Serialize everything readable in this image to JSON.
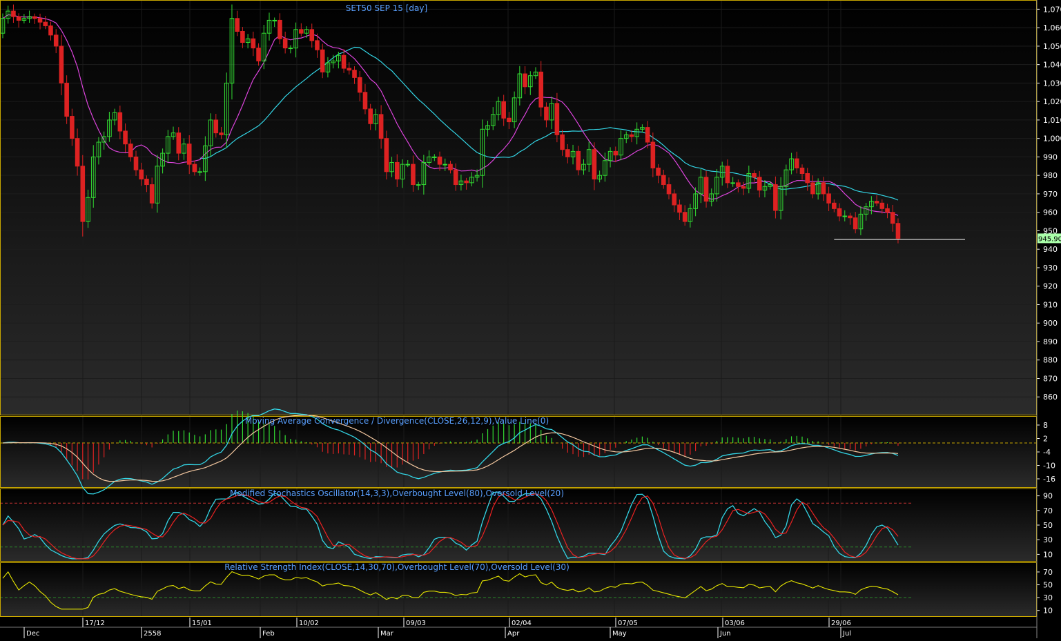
{
  "chart_data": [
    {
      "type": "candlestick",
      "title": "SET50 SEP 15   [day]",
      "ylim": [
        850,
        1075
      ],
      "yticks": [
        "1,070",
        "1,060",
        "1,050",
        "1,040",
        "1,030",
        "1,020",
        "1,010",
        "1,000",
        "990",
        "980",
        "970",
        "960",
        "950",
        "940",
        "930",
        "920",
        "910",
        "900",
        "890",
        "880",
        "870",
        "860"
      ],
      "last_price_label": "945.90",
      "support_line": 945.3,
      "close": [
        1065,
        1069,
        1066,
        1064,
        1065,
        1066,
        1065,
        1063,
        1061,
        1056,
        1050,
        1030,
        1012,
        1000,
        985,
        955,
        968,
        990,
        998,
        1001,
        1010,
        1014,
        1004,
        997,
        990,
        983,
        978,
        975,
        965,
        985,
        992,
        1001,
        1003,
        992,
        997,
        986,
        982,
        982,
        996,
        1010,
        1003,
        1002,
        1030,
        1065,
        1058,
        1052,
        1054,
        1049,
        1042,
        1057,
        1064,
        1064,
        1054,
        1049,
        1049,
        1059,
        1057,
        1059,
        1053,
        1048,
        1036,
        1041,
        1042,
        1045,
        1038,
        1037,
        1033,
        1025,
        1016,
        1008,
        1013,
        1000,
        982,
        987,
        978,
        986,
        986,
        975,
        975,
        987,
        990,
        990,
        986,
        986,
        983,
        975,
        977,
        976,
        979,
        980,
        1005,
        1007,
        1013,
        1020,
        1011,
        1009,
        1022,
        1035,
        1028,
        1034,
        1036,
        1017,
        1010,
        1019,
        1002,
        994,
        990,
        993,
        983,
        986,
        994,
        978,
        980,
        988,
        993,
        991,
        1000,
        1002,
        1001,
        1005,
        1006,
        998,
        984,
        980,
        975,
        970,
        964,
        960,
        955,
        962,
        970,
        979,
        966,
        970,
        979,
        985,
        976,
        976,
        974,
        973,
        981,
        979,
        972,
        974,
        975,
        961,
        974,
        983,
        989,
        984,
        981,
        976,
        970,
        976,
        970,
        965,
        962,
        958,
        958,
        957,
        951,
        959,
        963,
        966,
        965,
        962,
        960,
        954,
        945.9
      ],
      "overlays": [
        {
          "name": "MA slow",
          "color": "#33d6e6"
        },
        {
          "name": "MA fast",
          "color": "#dd44dd"
        }
      ],
      "x_tick_labels": [
        "17/12",
        "15/01",
        "10/02",
        "09/03",
        "02/04",
        "07/05",
        "03/06",
        "29/06"
      ],
      "x_month_labels": [
        "Dec",
        "2558",
        "Feb",
        "Mar",
        "Apr",
        "May",
        "Jun",
        "Jul"
      ]
    },
    {
      "type": "macd",
      "title": "Moving Average Convergence / Divergence(CLOSE,26,12,9),Value Line(0)",
      "yticks": [
        "8",
        "2",
        "-4",
        "-10",
        "-16"
      ],
      "ylim": [
        -20,
        12
      ]
    },
    {
      "type": "stochastic",
      "title": "Modified Stochastics Oscillator(14,3,3),Overbought Level(80),Oversold Level(20)",
      "yticks": [
        "90",
        "70",
        "50",
        "30",
        "10"
      ],
      "ylim": [
        0,
        100
      ],
      "levels": [
        80,
        20
      ]
    },
    {
      "type": "rsi",
      "title": "Relative Strength Index(CLOSE,14,30,70),Overbought Level(70),Oversold Level(30)",
      "yticks": [
        "70",
        "50",
        "30",
        "10"
      ],
      "ylim": [
        0,
        85
      ],
      "levels": [
        30
      ]
    }
  ],
  "colors": {
    "up": "#33dd33",
    "down": "#dd2222",
    "title": "#5aa0ff",
    "panel_border": "#c9a800",
    "axis_text": "#ffffff",
    "price_tag": "#aaffaa"
  }
}
